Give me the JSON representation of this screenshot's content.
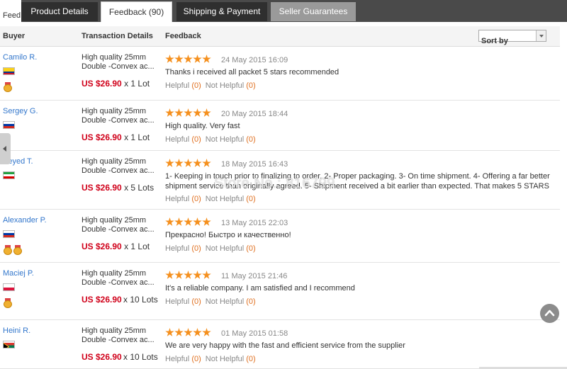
{
  "tabs": {
    "partial_label": "Feed",
    "items": [
      {
        "label": "Product Details"
      },
      {
        "label": "Feedback (90)"
      },
      {
        "label": "Shipping & Payment"
      },
      {
        "label": "Seller Guarantees"
      }
    ],
    "active_index": 1
  },
  "header": {
    "buyer": "Buyer",
    "transaction": "Transaction Details",
    "feedback": "Feedback",
    "sort_label": "Sort by"
  },
  "helpful_label": "Helpful",
  "not_helpful_label": "Not Helpful",
  "rows": [
    {
      "buyer": "Camilo R.",
      "flag": "colombia",
      "medals": 1,
      "product_line1": "High quality 25mm",
      "product_line2": "Double -Convex ac...",
      "price": "US $26.90",
      "quantity": "x 1 Lot",
      "rating": 5,
      "date": "24 May 2015 16:09",
      "text": "Thanks i received all packet 5 stars recommended",
      "helpful": "(0)",
      "not_helpful": "(0)"
    },
    {
      "buyer": "Sergey G.",
      "flag": "russia",
      "medals": 0,
      "product_line1": "High quality 25mm",
      "product_line2": "Double -Convex ac...",
      "price": "US $26.90",
      "quantity": "x 1 Lot",
      "rating": 5,
      "date": "20 May 2015 18:44",
      "text": "High quality. Very fast",
      "helpful": "(0)",
      "not_helpful": "(0)"
    },
    {
      "buyer": "Seyed T.",
      "flag": "iran",
      "medals": 0,
      "product_line1": "High quality 25mm",
      "product_line2": "Double -Convex ac...",
      "price": "US $26.90",
      "quantity": "x 5 Lots",
      "rating": 5,
      "date": "18 May 2015 16:43",
      "text": "1- Keeping in touch prior to finalizing to order. 2- Proper packaging. 3- On time shipment. 4- Offering a far better shipment service than originally agreed. 5- Shipment received a bit earlier than expected. That makes 5 STARS",
      "helpful": "(0)",
      "not_helpful": "(0)"
    },
    {
      "buyer": "Alexander P.",
      "flag": "russia",
      "medals": 2,
      "product_line1": "High quality 25mm",
      "product_line2": "Double -Convex ac...",
      "price": "US $26.90",
      "quantity": "x 1 Lot",
      "rating": 5,
      "date": "13 May 2015 22:03",
      "text": "Прекрасно! Быстро и качественно!",
      "helpful": "(0)",
      "not_helpful": "(0)"
    },
    {
      "buyer": "Maciej P.",
      "flag": "poland",
      "medals": 1,
      "product_line1": "High quality 25mm",
      "product_line2": "Double -Convex ac...",
      "price": "US $26.90",
      "quantity": "x 10 Lots",
      "rating": 5,
      "date": "11 May 2015 21:46",
      "text": "It's a reliable company. I am satisfied and I recommend",
      "helpful": "(0)",
      "not_helpful": "(0)"
    },
    {
      "buyer": "Heini R.",
      "flag": "south-africa",
      "medals": 0,
      "product_line1": "High quality 25mm",
      "product_line2": "Double -Convex ac...",
      "price": "US $26.90",
      "quantity": "x 10 Lots",
      "rating": 5,
      "date": "01 May 2015 01:58",
      "text": "We are very happy with the fast and efficient service from the supplier",
      "helpful": "(0)",
      "not_helpful": "(0)"
    }
  ],
  "watermark": "Store No.: 816799",
  "colors": {
    "accent_price": "#d0021b",
    "buyer_link": "#3377cc",
    "star": "#f5901e",
    "helpful_count": "#e07020",
    "tab_dark": "#2f2f2f",
    "tab_grey": "#9a9a9a"
  }
}
